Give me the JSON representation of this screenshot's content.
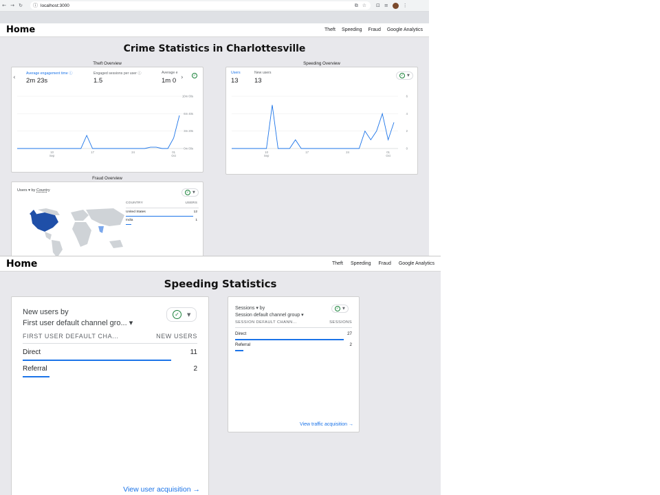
{
  "browser": {
    "url": "localhost:3000"
  },
  "app": {
    "home_label": "Home",
    "nav": [
      "Theft",
      "Speeding",
      "Fraud",
      "Google Analytics"
    ]
  },
  "page1": {
    "title": "Crime Statistics in Charlottesville",
    "theft": {
      "label": "Theft Overview",
      "metrics": [
        {
          "label": "Average engagement time ⓘ",
          "value": "2m 23s"
        },
        {
          "label": "Engaged sessions per user ⓘ",
          "value": "1.5"
        },
        {
          "label": "Average e",
          "value": "1m 0"
        }
      ],
      "y_ticks": [
        "10m 00s",
        "6m 40s",
        "3m 20s",
        "0m 00s"
      ],
      "x_ticks": [
        {
          "top": "10",
          "bottom": "Sep"
        },
        {
          "top": "17",
          "bottom": ""
        },
        {
          "top": "24",
          "bottom": ""
        },
        {
          "top": "01",
          "bottom": "Oct"
        }
      ]
    },
    "speeding": {
      "label": "Speeding Overview",
      "metrics": [
        {
          "label": "Users",
          "value": "13"
        },
        {
          "label": "New users",
          "value": "13"
        }
      ],
      "y_ticks": [
        "6",
        "4",
        "2",
        "0"
      ],
      "x_ticks": [
        {
          "top": "10",
          "bottom": "Sep"
        },
        {
          "top": "17",
          "bottom": ""
        },
        {
          "top": "24",
          "bottom": ""
        },
        {
          "top": "01",
          "bottom": "Oct"
        }
      ]
    },
    "fraud": {
      "label": "Fraud Overview",
      "card_title_a": "Users ▾",
      "card_title_b": "by",
      "card_title_c": "Country",
      "col_country": "COUNTRY",
      "col_users": "USERS",
      "rows": [
        {
          "name": "United States",
          "value": "12"
        },
        {
          "name": "India",
          "value": "1"
        }
      ]
    }
  },
  "page2": {
    "title": "Speeding Statistics",
    "big_card": {
      "title_line1": "New users by",
      "title_line2": "First user default channel gro... ▾",
      "col_left": "FIRST USER DEFAULT CHA...",
      "col_right": "NEW USERS",
      "rows": [
        {
          "name": "Direct",
          "value": "11"
        },
        {
          "name": "Referral",
          "value": "2"
        }
      ],
      "link": "View user acquisition →"
    },
    "small_card": {
      "title_line1": "Sessions ▾ by",
      "title_line2": "Session default channel group ▾",
      "col_left": "SESSION DEFAULT CHANN...",
      "col_right": "SESSIONS",
      "rows": [
        {
          "name": "Direct",
          "value": "27"
        },
        {
          "name": "Referral",
          "value": "2"
        }
      ],
      "link": "View traffic acquisition →"
    }
  },
  "chart_data": [
    {
      "type": "line",
      "title": "Theft Overview",
      "series": [
        {
          "name": "Average engagement time",
          "values": [
            0,
            0,
            0,
            0,
            0,
            0,
            0,
            0,
            0,
            0,
            0,
            0,
            150,
            0,
            0,
            0,
            0,
            0,
            0,
            0,
            0,
            0,
            0,
            15,
            15,
            0,
            0,
            120,
            380
          ]
        }
      ],
      "x": [
        "Sep 4",
        "Sep 5",
        "Sep 6",
        "Sep 7",
        "Sep 8",
        "Sep 9",
        "Sep 10",
        "Sep 11",
        "Sep 12",
        "Sep 13",
        "Sep 14",
        "Sep 15",
        "Sep 16",
        "Sep 17",
        "Sep 18",
        "Sep 19",
        "Sep 20",
        "Sep 21",
        "Sep 22",
        "Sep 23",
        "Sep 24",
        "Sep 25",
        "Sep 26",
        "Sep 27",
        "Sep 28",
        "Sep 29",
        "Sep 30",
        "Oct 1",
        "Oct 2"
      ],
      "ylim": [
        0,
        600
      ],
      "y_unit": "seconds"
    },
    {
      "type": "line",
      "title": "Speeding Overview",
      "series": [
        {
          "name": "Users",
          "values": [
            0,
            0,
            0,
            0,
            0,
            0,
            0,
            5,
            0,
            0,
            0,
            1,
            0,
            0,
            0,
            0,
            0,
            0,
            0,
            0,
            0,
            0,
            0,
            2,
            1,
            2,
            4,
            1,
            3
          ]
        }
      ],
      "x": [
        "Sep 4",
        "Sep 5",
        "Sep 6",
        "Sep 7",
        "Sep 8",
        "Sep 9",
        "Sep 10",
        "Sep 11",
        "Sep 12",
        "Sep 13",
        "Sep 14",
        "Sep 15",
        "Sep 16",
        "Sep 17",
        "Sep 18",
        "Sep 19",
        "Sep 20",
        "Sep 21",
        "Sep 22",
        "Sep 23",
        "Sep 24",
        "Sep 25",
        "Sep 26",
        "Sep 27",
        "Sep 28",
        "Sep 29",
        "Sep 30",
        "Oct 1",
        "Oct 2"
      ],
      "ylim": [
        0,
        6
      ]
    },
    {
      "type": "table",
      "title": "Users by Country",
      "categories": [
        "United States",
        "India"
      ],
      "values": [
        12,
        1
      ]
    },
    {
      "type": "bar",
      "title": "New users by First user default channel group",
      "categories": [
        "Direct",
        "Referral"
      ],
      "values": [
        11,
        2
      ]
    },
    {
      "type": "bar",
      "title": "Sessions by Session default channel group",
      "categories": [
        "Direct",
        "Referral"
      ],
      "values": [
        27,
        2
      ]
    }
  ]
}
